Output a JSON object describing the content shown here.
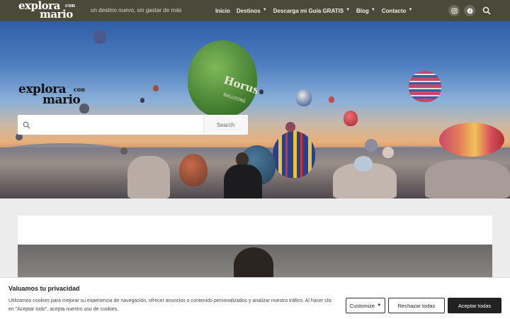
{
  "header": {
    "logo": {
      "word1": "explora",
      "word2": "con",
      "word3": "mario"
    },
    "tagline": "un destino nuevo, sin gastar de más",
    "nav": [
      {
        "label": "Inicio",
        "chevron": false
      },
      {
        "label": "Destinos",
        "chevron": true
      },
      {
        "label": "Descarga mi Guía GRATIS",
        "chevron": true
      },
      {
        "label": "Blog",
        "chevron": true
      },
      {
        "label": "Contacto",
        "chevron": true
      }
    ],
    "social_icons": [
      "instagram-icon",
      "pinterest-icon"
    ],
    "search_icon": "search-icon"
  },
  "hero": {
    "logo": {
      "word1": "explora",
      "word2": "con",
      "word3": "mario"
    },
    "search": {
      "placeholder": "",
      "button_label": "Search"
    }
  },
  "cookie": {
    "title": "Valuamos tu privacidad",
    "text": "Utilizamos cookies para mejorar su experiencia de navegación, ofrecer anuncios o contenido personalizados y analizar nuestro tráfico. Al hacer clic en \"Aceptar todo\", acepta nuestro uso de cookies.",
    "customize_label": "Customize",
    "reject_label": "Rechazar todas",
    "accept_label": "Aceptar todas"
  },
  "colors": {
    "header_bg": "#4a4a3a",
    "accept_bg": "#222222"
  }
}
